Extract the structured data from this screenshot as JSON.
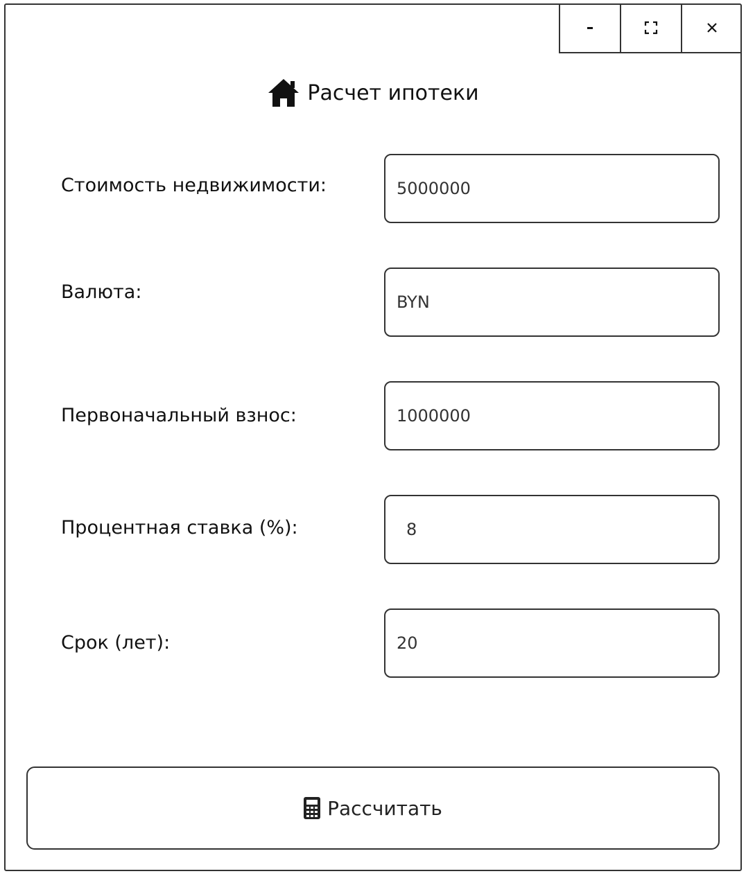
{
  "window": {
    "controls": {
      "minimize_label": "-",
      "maximize_label": "⛶",
      "close_label": "×"
    }
  },
  "header": {
    "icon": "home-icon",
    "title": "Расчет ипотеки"
  },
  "form": {
    "fields": [
      {
        "label": "Стоимость недвижимости:",
        "value": "5000000"
      },
      {
        "label": "Валюта:",
        "value": "BYN"
      },
      {
        "label": "Первоначальный взнос:",
        "value": "1000000"
      },
      {
        "label": "Процентная ставка (%):",
        "value": "8"
      },
      {
        "label": "Срок (лет):",
        "value": "20"
      }
    ]
  },
  "actions": {
    "calculate_icon": "calculator-icon",
    "calculate_label": "Рассчитать"
  },
  "colors": {
    "border": "#333333",
    "text": "#111111",
    "background": "#ffffff"
  }
}
